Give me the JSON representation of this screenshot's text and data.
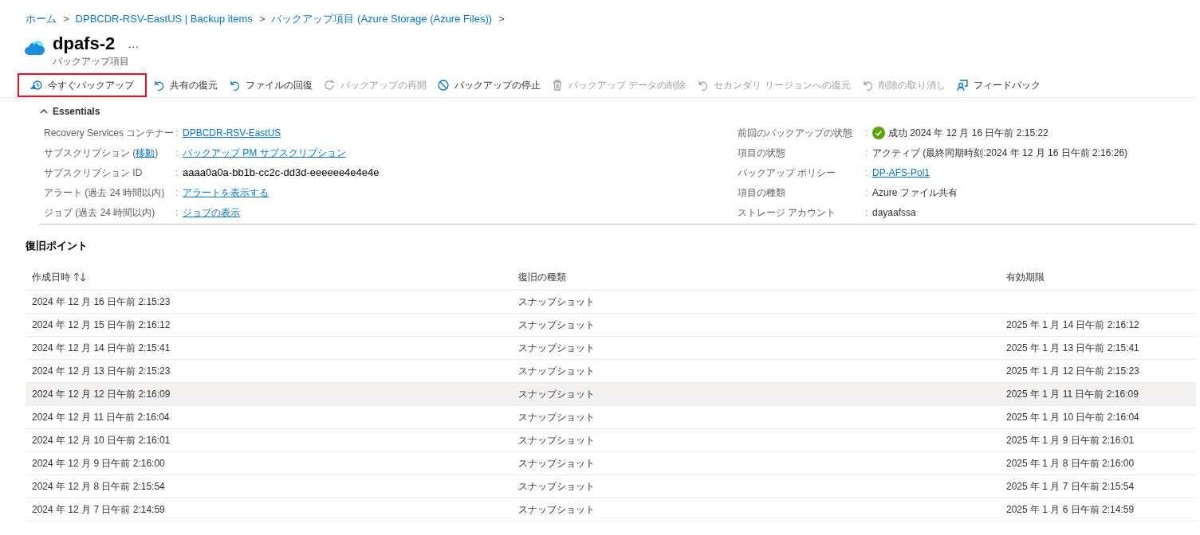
{
  "breadcrumb": [
    {
      "label": "ホーム"
    },
    {
      "label": "DPBCDR-RSV-EastUS | Backup items"
    },
    {
      "label": "バックアップ項目 (Azure Storage (Azure Files))"
    }
  ],
  "breadcrumb_separator": ">",
  "header": {
    "title": "dpafs-2",
    "more": "…",
    "subtitle": "バックアップ項目"
  },
  "toolbar": [
    {
      "kind": "backup",
      "label": "今すぐバックアップ",
      "disabled": false,
      "highlighted": true
    },
    {
      "kind": "undo",
      "label": "共有の復元",
      "disabled": false,
      "highlighted": false
    },
    {
      "kind": "undo",
      "label": "ファイルの回復",
      "disabled": false,
      "highlighted": false
    },
    {
      "kind": "refresh",
      "label": "バックアップの再開",
      "disabled": true,
      "highlighted": false
    },
    {
      "kind": "stop",
      "label": "バックアップの停止",
      "disabled": false,
      "highlighted": false
    },
    {
      "kind": "trash",
      "label": "バックアップ データの削除",
      "disabled": true,
      "highlighted": false
    },
    {
      "kind": "undo",
      "label": "セカンダリ リージョンへの復元",
      "disabled": true,
      "highlighted": false
    },
    {
      "kind": "undo",
      "label": "削除の取り消し",
      "disabled": true,
      "highlighted": false
    },
    {
      "kind": "feedback",
      "label": "フィードバック",
      "disabled": false,
      "highlighted": false
    }
  ],
  "essentials": {
    "title": "Essentials",
    "expanded": true,
    "left": [
      {
        "label": "Recovery Services コンテナー",
        "sep": ":",
        "value": "DPBCDR-RSV-EastUS",
        "link": true
      },
      {
        "label": "サブスクリプション (",
        "label_link": "移動",
        "label_suffix": ")",
        "sep": ":",
        "value": "バックアップ PM サブスクリプション",
        "link": true
      },
      {
        "label": "サブスクリプション ID",
        "sep": ":",
        "value": "aaaa0a0a-bb1b-cc2c-dd3d-eeeeee4e4e4e",
        "link": false
      },
      {
        "label": "アラート (過去 24 時間以内)",
        "sep": ":",
        "value": "アラートを表示する",
        "link": true
      },
      {
        "label": "ジョブ (過去 24 時間以内)",
        "sep": ":",
        "value": "ジョブの表示",
        "link": true
      }
    ],
    "right": [
      {
        "label": "前回のバックアップの状態",
        "sep": ":",
        "value": "成功 2024 年 12 月 16 日午前 2:15:22",
        "link": false,
        "kind": "success"
      },
      {
        "label": "項目の状態",
        "sep": ":",
        "value": "アクティブ (最終同期時刻:2024 年 12 月 16 日午前 2:16:26)",
        "link": false
      },
      {
        "label": "バックアップ ポリシー",
        "sep": ":",
        "value": "DP-AFS-Pol1",
        "link": true
      },
      {
        "label": "項目の種類",
        "sep": ":",
        "value": "Azure ファイル共有",
        "link": false
      },
      {
        "label": "ストレージ アカウント",
        "sep": ":",
        "value": "dayaafssa",
        "link": false
      }
    ]
  },
  "recovery_points": {
    "title": "復旧ポイント",
    "columns": [
      {
        "label": "作成日時",
        "sortable": true
      },
      {
        "label": "復旧の種類",
        "sortable": false
      },
      {
        "label": "有効期限",
        "sortable": false
      }
    ],
    "rows": [
      {
        "created": "2024 年 12 月 16 日午前 2:15:23",
        "type": "スナップショット",
        "highlighted": false
      },
      {
        "created": "2024 年 12 月 15 日午前 2:16:12",
        "type": "スナップショット",
        "expires": "2025 年 1 月 14 日午前 2:16:12",
        "highlighted": false
      },
      {
        "created": "2024 年 12 月 14 日午前 2:15:41",
        "type": "スナップショット",
        "expires": "2025 年 1 月 13 日午前 2:15:41",
        "highlighted": false
      },
      {
        "created": "2024 年 12 月 13 日午前 2:15:23",
        "type": "スナップショット",
        "expires": "2025 年 1 月 12 日午前 2:15:23",
        "highlighted": false
      },
      {
        "created": "2024 年 12 月 12 日午前 2:16:09",
        "type": "スナップショット",
        "expires": "2025 年 1 月 11 日午前 2:16:09",
        "highlighted": true
      },
      {
        "created": "2024 年 12 月 11 日午前 2:16:04",
        "type": "スナップショット",
        "expires": "2025 年 1 月 10 日午前 2:16:04",
        "highlighted": false
      },
      {
        "created": "2024 年 12 月 10 日午前 2:16:01",
        "type": "スナップショット",
        "expires": "2025 年 1 月 9 日午前 2:16:01",
        "highlighted": false
      },
      {
        "created": "2024 年 12 月 9 日午前 2:16:00",
        "type": "スナップショット",
        "expires": "2025 年 1 月 8 日午前 2:16:00",
        "highlighted": false
      },
      {
        "created": "2024 年 12 月 8 日午前 2:15:54",
        "type": "スナップショット",
        "expires": "2025 年 1 月 7 日午前 2:15:54",
        "highlighted": false
      },
      {
        "created": "2024 年 12 月 7 日午前 2:14:59",
        "type": "スナップショット",
        "expires": "2025 年 1 月 6 日午前 2:14:59",
        "highlighted": false
      }
    ]
  }
}
